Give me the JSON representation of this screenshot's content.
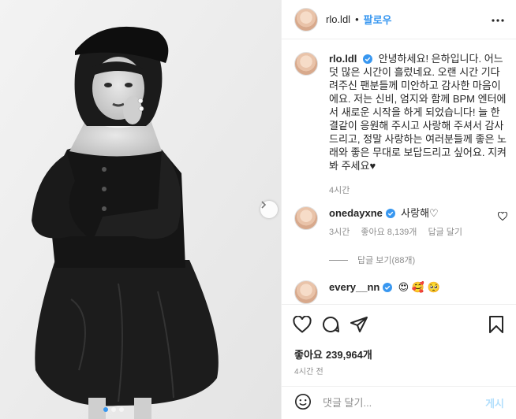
{
  "post": {
    "author": "rlo.ldl",
    "follow_label": "팔로우",
    "separator": "•",
    "caption": "안녕하세요! 은하입니다. 어느덧 많은 시간이 흘렀네요. 오랜 시간 기다려주신 팬분들께 미안하고 감사한 마음이에요. 저는 신비, 엄지와 함께 BPM 엔터에서 새로운 시작을 하게 되었습니다! 늘 한결같이 응원해 주시고 사랑해 주셔서 감사드리고, 정말 사랑하는 여러분들께 좋은 노래와 좋은 무대로 보답드리고 싶어요. 지켜봐 주세요♥",
    "caption_time": "4시간",
    "likes_label": "좋아요",
    "likes_count": "239,964개",
    "posted_time": "4시간 전"
  },
  "comments": [
    {
      "user": "onedayxne",
      "text": "사랑해♡",
      "time": "3시간",
      "likes": "좋아요 8,139개",
      "reply_label": "답글 달기",
      "view_replies": "답글 보기(88개)"
    },
    {
      "user": "every__nn",
      "emoji": [
        "😍",
        "🥰",
        "🥺"
      ]
    }
  ],
  "add_comment": {
    "placeholder": "댓글 달기...",
    "post_label": "게시"
  },
  "icons": {
    "more": "more-horizontal-icon",
    "like": "heart-icon",
    "comment": "comment-icon",
    "share": "paper-plane-icon",
    "save": "bookmark-icon",
    "emoji": "smiley-icon",
    "next": "chevron-right-icon",
    "verified": "verified-badge-icon"
  },
  "colors": {
    "accent": "#3897f0",
    "text": "#262626",
    "muted": "#8e8e8e",
    "border": "#efefef",
    "post_disabled": "#b2dffc"
  },
  "carousel": {
    "total": 3,
    "current": 1
  }
}
